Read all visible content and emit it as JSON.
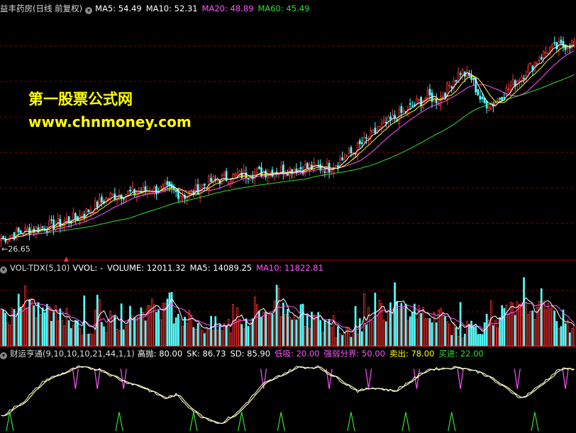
{
  "stock": {
    "title": "益丰药房(日线 前复权)"
  },
  "ma_header": [
    {
      "label": "MA5: 54.49",
      "color": "#ffffff"
    },
    {
      "label": "MA10: 52.31",
      "color": "#ffffff"
    },
    {
      "label": "MA20: 48.89",
      "color": "#ff55ff"
    },
    {
      "label": "MA60: 45.49",
      "color": "#33dd33"
    }
  ],
  "watermark": {
    "line1": "第一股票公式网",
    "line2": "www.chnmoney.com"
  },
  "low_label": "26.65",
  "vol_header": {
    "name": "VOL-TDX(5,10)",
    "items": [
      {
        "label": "VVOL: -",
        "color": "#ffffff"
      },
      {
        "label": "VOLUME: 12011.32",
        "color": "#ffffff"
      },
      {
        "label": "MA5: 14089.25",
        "color": "#ffffff"
      },
      {
        "label": "MA10: 11822.81",
        "color": "#ff55ff"
      }
    ]
  },
  "ind_header": {
    "name": "财运亨通(9,10,10,10,21,44,1,1)",
    "items": [
      {
        "label": "高抛: 80.00",
        "color": "#ffffff"
      },
      {
        "label": "SK: 86.73",
        "color": "#ffffff"
      },
      {
        "label": "SD: 85.90",
        "color": "#ffffff"
      },
      {
        "label": "低吸: 20.00",
        "color": "#ff55ff"
      },
      {
        "label": "强弱分界: 50.00",
        "color": "#ff55ff"
      },
      {
        "label": "卖出: 78.00",
        "color": "#ffff00"
      },
      {
        "label": "买进: 22.00",
        "color": "#33dd33"
      }
    ]
  },
  "colors": {
    "up": "#ff3333",
    "down": "#54ffff",
    "ma5": "#ffffff",
    "ma10": "#ffff00",
    "ma20": "#ff55ff",
    "ma60": "#33dd33",
    "grid": "#8b0000"
  },
  "chart_data": [
    {
      "type": "candlestick",
      "panel": "price",
      "ylim": [
        26,
        60
      ],
      "close_anchors": [
        [
          0,
          28.5
        ],
        [
          10,
          29.5
        ],
        [
          25,
          30.5
        ],
        [
          35,
          31.5
        ],
        [
          50,
          34.5
        ],
        [
          60,
          35.0
        ],
        [
          75,
          35.5
        ],
        [
          85,
          34.5
        ],
        [
          95,
          36.5
        ],
        [
          110,
          37.5
        ],
        [
          125,
          38.0
        ],
        [
          140,
          38.5
        ],
        [
          150,
          38.5
        ],
        [
          160,
          40.5
        ],
        [
          175,
          44.5
        ],
        [
          185,
          46.5
        ],
        [
          195,
          48.5
        ],
        [
          200,
          48.0
        ],
        [
          210,
          52.0
        ],
        [
          215,
          51.0
        ],
        [
          220,
          47.5
        ],
        [
          225,
          47.5
        ],
        [
          240,
          52.0
        ],
        [
          250,
          55.0
        ],
        [
          262,
          56.0
        ]
      ],
      "series": [
        {
          "name": "MA5",
          "value": 54.49
        },
        {
          "name": "MA10",
          "value": 52.31
        },
        {
          "name": "MA20",
          "value": 48.89
        },
        {
          "name": "MA60",
          "value": 45.49
        }
      ]
    },
    {
      "type": "bar",
      "panel": "volume",
      "ylim": [
        0,
        40000
      ],
      "last": {
        "volume": 12011.32,
        "ma5": 14089.25,
        "ma10": 11822.81
      }
    },
    {
      "type": "line",
      "panel": "indicator",
      "ylim": [
        0,
        100
      ],
      "levels": {
        "high_sell": 80,
        "low_buy": 20,
        "midline": 50,
        "sell": 78,
        "buy": 22
      },
      "last": {
        "sk": 86.73,
        "sd": 85.9
      },
      "oscillator_anchors": [
        [
          0,
          20
        ],
        [
          10,
          40
        ],
        [
          20,
          70
        ],
        [
          35,
          88
        ],
        [
          45,
          85
        ],
        [
          55,
          70
        ],
        [
          65,
          60
        ],
        [
          75,
          45
        ],
        [
          80,
          50
        ],
        [
          90,
          22
        ],
        [
          100,
          10
        ],
        [
          108,
          25
        ],
        [
          120,
          65
        ],
        [
          135,
          88
        ],
        [
          145,
          88
        ],
        [
          155,
          70
        ],
        [
          163,
          55
        ],
        [
          170,
          60
        ],
        [
          180,
          55
        ],
        [
          195,
          85
        ],
        [
          210,
          88
        ],
        [
          220,
          80
        ],
        [
          230,
          60
        ],
        [
          238,
          45
        ],
        [
          245,
          60
        ],
        [
          255,
          85
        ],
        [
          262,
          86
        ]
      ],
      "buy_signals": [
        4,
        54,
        88,
        110,
        128,
        160,
        185,
        206,
        244
      ],
      "sell_spikes": [
        34,
        44,
        56,
        120,
        150,
        168,
        190,
        210,
        236,
        258
      ]
    }
  ]
}
